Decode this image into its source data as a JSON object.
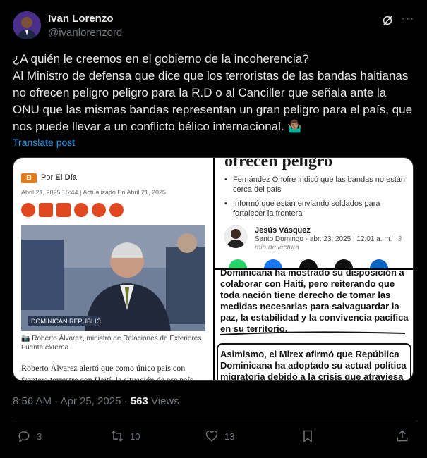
{
  "author": {
    "name": "Ivan Lorenzo",
    "handle": "@ivanlorenzord"
  },
  "tweet": {
    "text": "¿A quién le creemos en el gobierno de la incoherencia?\nAl Ministro de defensa que dice que los terroristas de las bandas haitianas no ofrecen peligro peligro para la R.D o al Canciller que señala ante la ONU que las mismas bandas representan un gran peligro para el país, que nos puede llevar a un conflicto bélico internacional. 🤷🏽‍♂️",
    "translate_label": "Translate post"
  },
  "media": {
    "panel1": {
      "logo_text": "El Día",
      "byline_prefix": "Por",
      "byline_source": "El Día",
      "dateline": "Abril 21, 2025 15:44 | Actualizado En Abril 21, 2025",
      "caption": "📷 Roberto Álvarez, ministro de Relaciones de Exteriores. Fuente externa",
      "body": "Roberto Álvarez alertó que como único país con frontera terrestre con Haití, la situación de ese país"
    },
    "panel2": {
      "headline": "ofrecen peligro",
      "bullets": [
        "Fernández Onofre indicó que las bandas no están cerca del país",
        "Informó que están enviando soldados para fortalecer la frontera"
      ],
      "author": "Jesús Vásquez",
      "meta": "Santo Domingo - abr. 23, 2025 | 12:01 a. m. |",
      "read_time": "3 min de lectura"
    },
    "panel3": {
      "text_top": "Dominicana ha mostrado su disposición a colaborar con Haití, pero reiterando que toda nación tiene derecho de tomar las medidas necesarias para salvaguardar la paz, la estabilidad y la convivencia pacífica en su territorio.",
      "text_bottom": "Asimismo, el Mirex afirmó que República Dominicana ha adoptado su actual política migratoria debido a la crisis que atraviesa"
    }
  },
  "meta": {
    "time": "8:56 AM · Apr 25, 2025 · ",
    "views_count": "563",
    "views_label": " Views"
  },
  "actions": {
    "replies": "3",
    "reposts": "10",
    "likes": "13"
  },
  "colors": {
    "link": "#1d9bf0",
    "muted": "#71767b",
    "text": "#e7e9ea",
    "background": "#000000"
  }
}
